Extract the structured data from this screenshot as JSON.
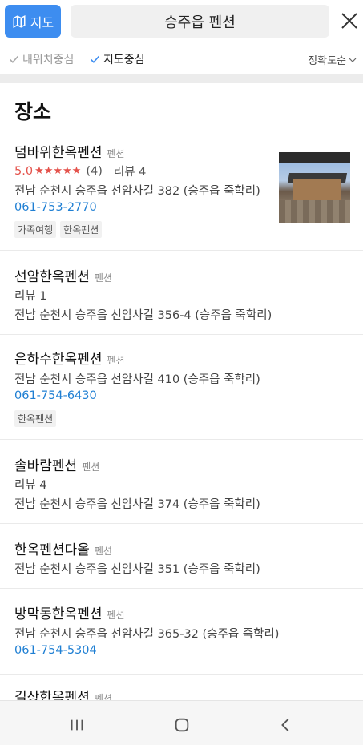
{
  "header": {
    "map_button_label": "지도",
    "search_query": "승주읍 펜션"
  },
  "filters": {
    "my_location": "내위치중심",
    "map_center": "지도중심",
    "sort": "정확도순"
  },
  "section_title": "장소",
  "places": [
    {
      "name": "덤바위한옥펜션",
      "category": "펜션",
      "rating": "5.0",
      "stars": "★★★★★",
      "rating_count": "(4)",
      "review": "리뷰 4",
      "address": "전남 순천시 승주읍 선암사길 382 (승주읍 죽학리)",
      "phone": "061-753-2770",
      "tags": [
        "가족여행",
        "한옥펜션"
      ],
      "has_thumbnail": true
    },
    {
      "name": "선암한옥펜션",
      "category": "펜션",
      "review": "리뷰 1",
      "address": "전남 순천시 승주읍 선암사길 356-4 (승주읍 죽학리)"
    },
    {
      "name": "은하수한옥펜션",
      "category": "펜션",
      "address": "전남 순천시 승주읍 선암사길 410 (승주읍 죽학리)",
      "phone": "061-754-6430",
      "tags": [
        "한옥펜션"
      ]
    },
    {
      "name": "솔바람펜션",
      "category": "펜션",
      "review": "리뷰 4",
      "address": "전남 순천시 승주읍 선암사길 374 (승주읍 죽학리)"
    },
    {
      "name": "한옥펜션다올",
      "category": "펜션",
      "address": "전남 순천시 승주읍 선암사길 351 (승주읍 죽학리)"
    },
    {
      "name": "방막동한옥펜션",
      "category": "펜션",
      "address": "전남 순천시 승주읍 선암사길 365-32 (승주읍 죽학리)",
      "phone": "061-754-5304"
    },
    {
      "name": "길상한옥펜션",
      "category": "펜션"
    }
  ],
  "colors": {
    "accent": "#3d8df0",
    "rating": "#e4524b",
    "phone": "#1f7fd3"
  },
  "icons": {
    "map_button": "map-icon",
    "close": "close-icon",
    "check": "check-icon",
    "sort": "chevron-down-icon",
    "nav_recent": "recent-apps-icon",
    "nav_home": "home-icon",
    "nav_back": "back-icon"
  }
}
